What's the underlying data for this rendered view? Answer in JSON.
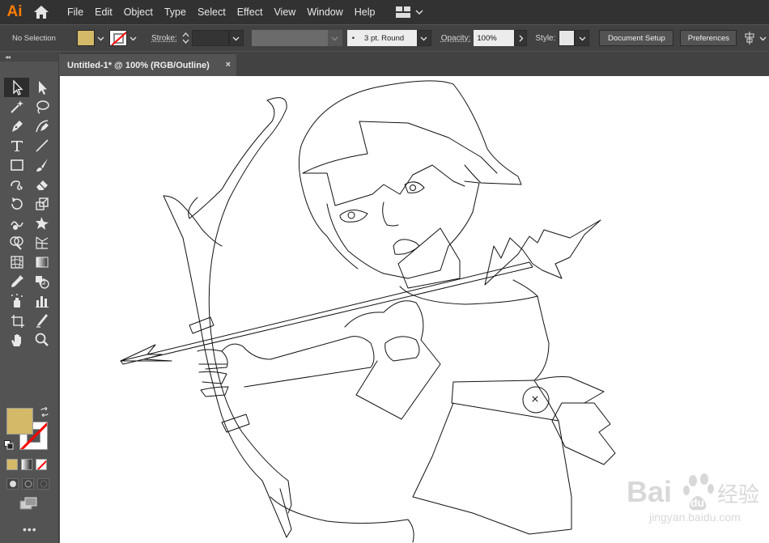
{
  "app": {
    "logo": "Ai"
  },
  "menu": [
    "File",
    "Edit",
    "Object",
    "Type",
    "Select",
    "Effect",
    "View",
    "Window",
    "Help"
  ],
  "control": {
    "selection_status": "No Selection",
    "stroke_label": "Stroke:",
    "brush": "3 pt. Round",
    "opacity_label": "Opacity:",
    "opacity_value": "100%",
    "style_label": "Style:",
    "doc_setup": "Document Setup",
    "preferences": "Preferences"
  },
  "document": {
    "tab_title": "Untitled-1* @ 100% (RGB/Outline)",
    "close": "×"
  },
  "colors": {
    "fill": "#d4b968",
    "stroke_none": "#ff0000",
    "ui_dark": "#323232",
    "canvas": "#ffffff"
  },
  "tools": [
    "selection-tool",
    "direct-selection-tool",
    "magic-wand-tool",
    "lasso-tool",
    "pen-tool",
    "curvature-tool",
    "type-tool",
    "line-segment-tool",
    "rectangle-tool",
    "paintbrush-tool",
    "shaper-tool",
    "eraser-tool",
    "rotate-tool",
    "scale-tool",
    "warp-tool",
    "free-transform-tool",
    "shape-builder-tool",
    "perspective-grid-tool",
    "mesh-tool",
    "gradient-tool",
    "eyedropper-tool",
    "blend-tool",
    "symbol-sprayer-tool",
    "column-graph-tool",
    "artboard-tool",
    "slice-tool",
    "hand-tool",
    "zoom-tool"
  ],
  "more_tools": "•••",
  "watermark": {
    "brand": "Bai",
    "paw": "du",
    "cn": "经验",
    "url": "jingyan.baidu.com"
  }
}
